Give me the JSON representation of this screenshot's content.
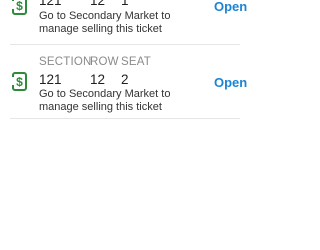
{
  "tickets": [
    {
      "section": "121",
      "row": "12",
      "seat": "1",
      "description": "Go to Secondary Market to manage selling this ticket",
      "action": "Open",
      "icon": "dollar-document-icon"
    },
    {
      "headers": {
        "section": "SECTION",
        "row": "ROW",
        "seat": "SEAT"
      },
      "section": "121",
      "row": "12",
      "seat": "2",
      "description": "Go to Secondary Market to manage selling this ticket",
      "action": "Open",
      "icon": "dollar-document-icon"
    }
  ],
  "colors": {
    "accent": "#1a84d6",
    "icon": "#2e8b3a",
    "label": "#8a8a8a"
  }
}
